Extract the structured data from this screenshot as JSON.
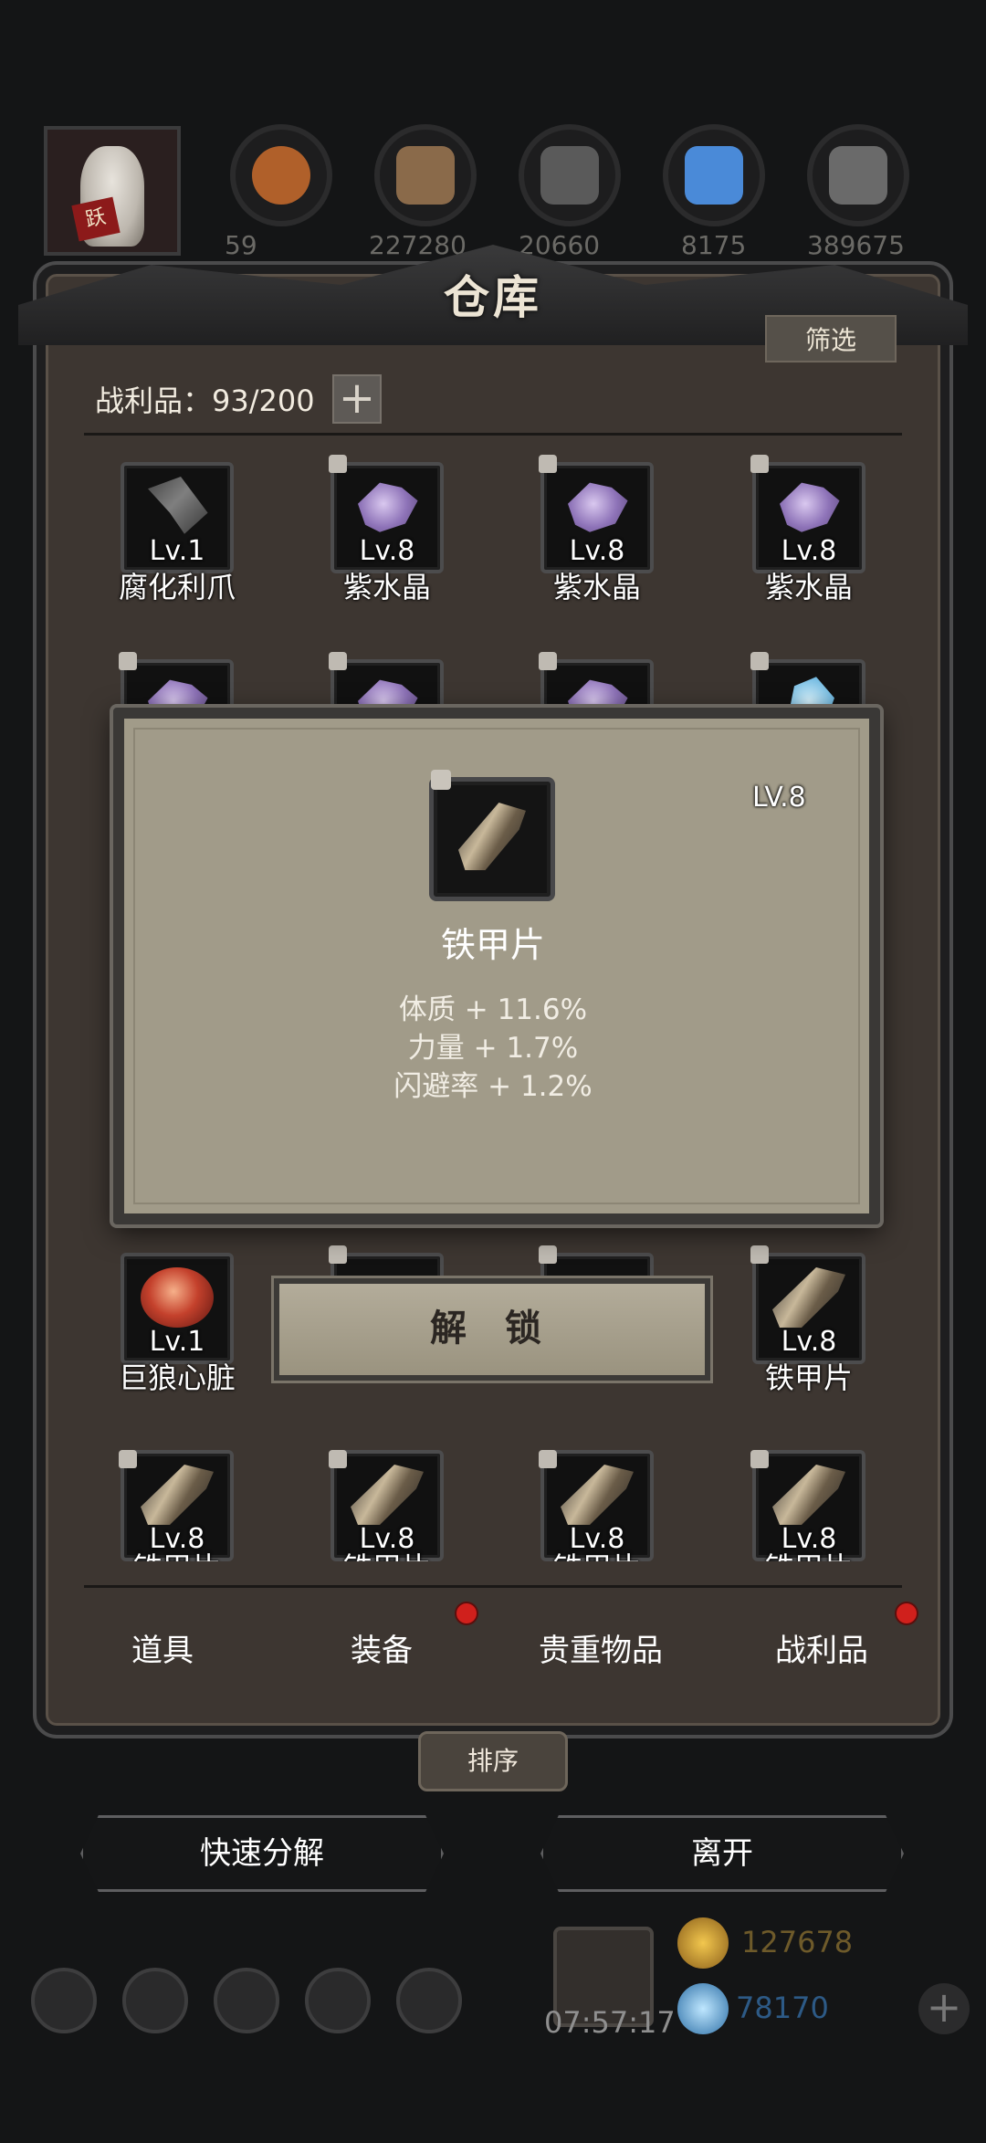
{
  "top_resources": {
    "values": [
      "59",
      "227280",
      "20660",
      "8175",
      "389675"
    ],
    "colors": [
      "#b0602a",
      "#8a6a4a",
      "#5a5a5a",
      "#4a8ad8",
      "#6a6a6a"
    ]
  },
  "panel": {
    "title": "仓库",
    "filter_label": "筛选",
    "capacity_label": "战利品：93/200",
    "add_icon": "+"
  },
  "items_row1": [
    {
      "level": "Lv.1",
      "name": "腐化利爪",
      "icon": "claw-icon",
      "locked": false
    },
    {
      "level": "Lv.8",
      "name": "紫水晶",
      "icon": "crystal-icon",
      "locked": true
    },
    {
      "level": "Lv.8",
      "name": "紫水晶",
      "icon": "crystal-icon",
      "locked": true
    },
    {
      "level": "Lv.8",
      "name": "紫水晶",
      "icon": "crystal-icon",
      "locked": true
    }
  ],
  "items_row4": [
    {
      "level": "Lv.1",
      "name": "巨狼心脏",
      "icon": "heart-icon",
      "locked": false
    },
    {
      "level": "",
      "name": "",
      "icon": "",
      "locked": true
    },
    {
      "level": "",
      "name": "",
      "icon": "",
      "locked": true
    },
    {
      "level": "Lv.8",
      "name": "铁甲片",
      "icon": "plate-icon",
      "locked": true
    }
  ],
  "items_row5": [
    {
      "level": "Lv.8",
      "name": "铁甲片",
      "icon": "plate-icon",
      "locked": true
    },
    {
      "level": "Lv.8",
      "name": "铁甲片",
      "icon": "plate-icon",
      "locked": true
    },
    {
      "level": "Lv.8",
      "name": "铁甲片",
      "icon": "plate-icon",
      "locked": true
    },
    {
      "level": "Lv.8",
      "name": "铁甲片",
      "icon": "plate-icon",
      "locked": true
    }
  ],
  "detail": {
    "level": "LV.8",
    "name": "铁甲片",
    "stats": [
      "体质 + 11.6%",
      "力量 + 1.7%",
      "闪避率 + 1.2%"
    ]
  },
  "unlock_label": "解 锁",
  "tabs": [
    {
      "label": "道具",
      "badge": false
    },
    {
      "label": "装备",
      "badge": true
    },
    {
      "label": "贵重物品",
      "badge": false
    },
    {
      "label": "战利品",
      "badge": true
    }
  ],
  "sort_label": "排序",
  "quick_decompose_label": "快速分解",
  "leave_label": "离开",
  "bottom": {
    "timer": "07:57:17",
    "gold": "127678",
    "gems": "78170",
    "add_icon": "+"
  },
  "portrait_tag": "跃"
}
